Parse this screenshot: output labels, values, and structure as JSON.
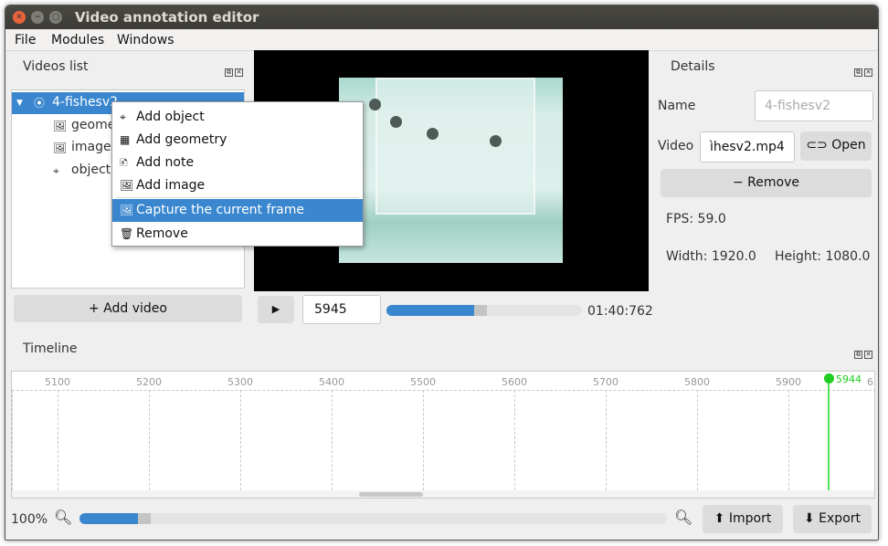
{
  "window": {
    "title": "Video annotation editor"
  },
  "menu": [
    "File",
    "Modules",
    "Windows"
  ],
  "videos_panel": {
    "title": "Videos list",
    "tree": {
      "root": "4-fishesv2",
      "children": [
        "geome",
        "image",
        "object"
      ]
    },
    "add_video_label": "+ Add video"
  },
  "context_menu": {
    "items": [
      "Add object",
      "Add geometry",
      "Add note",
      "Add image",
      "Capture the current frame",
      "Remove"
    ],
    "highlighted": "Capture the current frame"
  },
  "player": {
    "frame_value": "5945",
    "time": "01:40:762",
    "progress": 0.45
  },
  "details": {
    "title": "Details",
    "name_label": "Name",
    "name_placeholder": "4-fishesv2",
    "video_label": "Video",
    "video_value": "ìhesv2.mp4",
    "open_label": "Open",
    "remove_label": "− Remove",
    "fps": "FPS: 59.0",
    "width": "Width: 1920.0",
    "height": "Height: 1080.0"
  },
  "timeline": {
    "title": "Timeline",
    "ticks": [
      "5100",
      "5200",
      "5300",
      "5400",
      "5500",
      "5600",
      "5700",
      "5800",
      "5900",
      "6"
    ],
    "cursor_label": "5944",
    "zoom_label": "100%",
    "zoom_level": 0.1,
    "import_label": "Import",
    "export_label": "Export"
  },
  "colors": {
    "accent": "#3a87cf",
    "cursor": "#22cc22",
    "titlebar": "#3c3b37"
  }
}
